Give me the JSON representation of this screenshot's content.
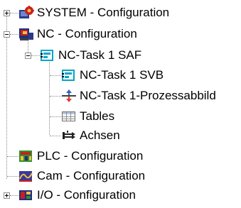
{
  "tree": {
    "system": {
      "label": "SYSTEM - Configuration",
      "icon": "system-config-icon",
      "expanded": false
    },
    "nc": {
      "label": "NC - Configuration",
      "icon": "nc-config-icon",
      "expanded": true,
      "task_saf": {
        "label": "NC-Task 1 SAF",
        "icon": "nc-task-icon",
        "expanded": true,
        "children": [
          {
            "label": "NC-Task 1 SVB",
            "icon": "nc-task-icon"
          },
          {
            "label": "NC-Task 1-Prozessabbild",
            "icon": "process-image-icon"
          },
          {
            "label": "Tables",
            "icon": "table-icon"
          },
          {
            "label": "Achsen",
            "icon": "axes-icon"
          }
        ]
      }
    },
    "plc": {
      "label": "PLC - Configuration",
      "icon": "plc-config-icon"
    },
    "cam": {
      "label": "Cam - Configuration",
      "icon": "cam-config-icon"
    },
    "io": {
      "label": "I/O - Configuration",
      "icon": "io-config-icon",
      "expanded": false
    }
  },
  "colors": {
    "connector": "#8a8a8a",
    "task_cyan": "#00a6c8",
    "system_red": "#c8201e",
    "plc_green": "#2f8f2f",
    "arrow_red": "#e23a2a",
    "arrow_blue": "#3060c0"
  }
}
